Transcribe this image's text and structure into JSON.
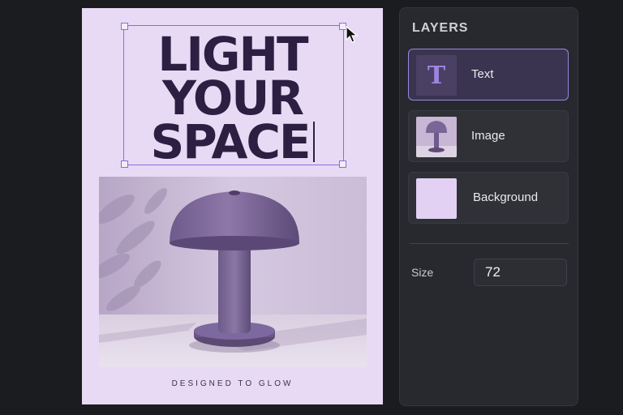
{
  "poster": {
    "headline": [
      "LIGHT",
      "YOUR",
      "SPACE"
    ],
    "tagline": "DESIGNED TO GLOW"
  },
  "layers_panel": {
    "title": "LAYERS",
    "items": [
      {
        "label": "Text",
        "thumb_glyph": "T",
        "active": true
      },
      {
        "label": "Image",
        "active": false
      },
      {
        "label": "Background",
        "active": false
      }
    ],
    "size_label": "Size",
    "size_value": "72"
  },
  "colors": {
    "accent": "#8a6fd6",
    "poster_background": "#e8daf5",
    "headline_text": "#2d1f42",
    "panel_background": "#27292e"
  },
  "icons": [
    "text-layer-icon",
    "cursor-arrow-icon"
  ]
}
